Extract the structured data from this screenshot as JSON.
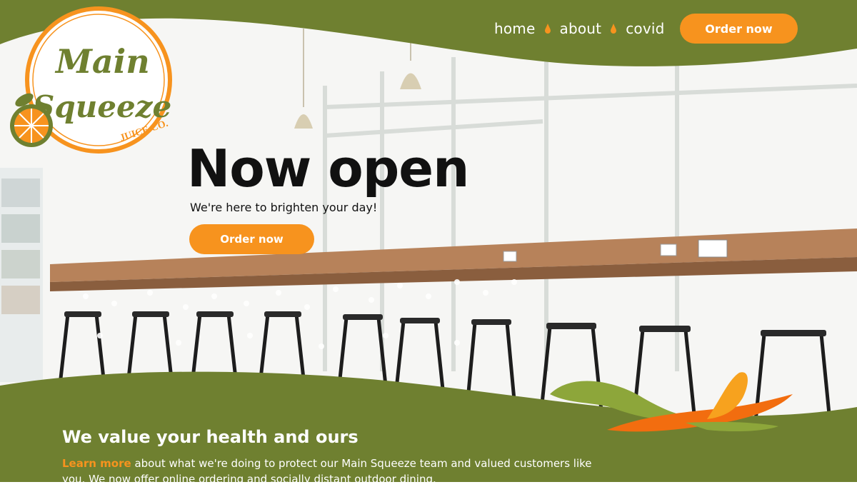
{
  "brand": {
    "logo_text_main": "Main",
    "logo_text_squeeze": "Squeeze",
    "logo_text_co": "JUICE CO.",
    "colors": {
      "green": "#6f8030",
      "orange": "#f7931e",
      "dark": "#111111",
      "white": "#ffffff"
    }
  },
  "nav": {
    "items": [
      {
        "label": "home"
      },
      {
        "label": "about"
      },
      {
        "label": "covid"
      }
    ],
    "separator_icon": "juice-drop-icon",
    "order_button": "Order now"
  },
  "hero": {
    "title": "Now open",
    "subtitle": "We're here to brighten your day!",
    "order_button": "Order now"
  },
  "section": {
    "title": "We value your health and ours",
    "link_text": "Learn more",
    "body_text": " about what we're doing to protect our Main Squeeze team and valued customers like you. We now offer online ordering and socially distant outdoor dining."
  }
}
